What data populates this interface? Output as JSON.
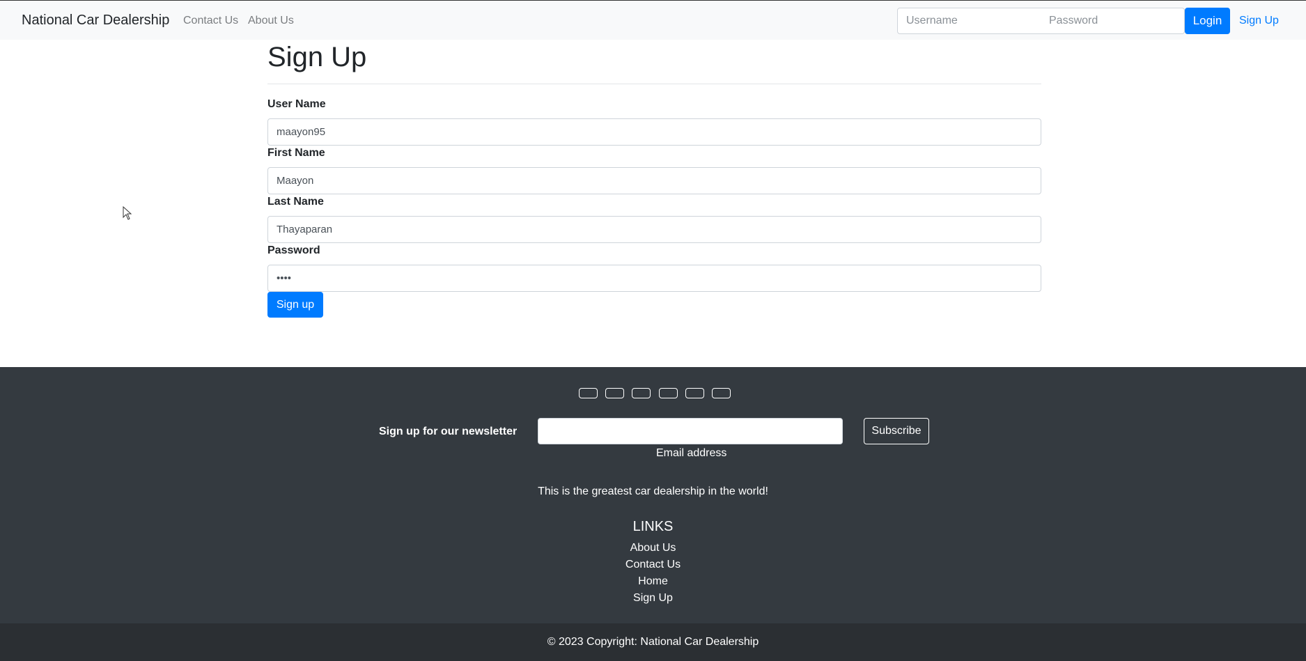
{
  "navbar": {
    "brand": "National Car Dealership",
    "links": [
      "Contact Us",
      "About Us"
    ],
    "username_placeholder": "Username",
    "password_placeholder": "Password",
    "login_label": "Login",
    "signup_label": "Sign Up"
  },
  "form": {
    "title": "Sign Up",
    "username_label": "User Name",
    "username_value": "maayon95",
    "firstname_label": "First Name",
    "firstname_value": "Maayon",
    "lastname_label": "Last Name",
    "lastname_value": "Thayaparan",
    "password_label": "Password",
    "password_value": "abcd",
    "submit_label": "Sign up"
  },
  "footer": {
    "social_icons": [
      "social-icon-1",
      "social-icon-2",
      "social-icon-3",
      "social-icon-4",
      "social-icon-5",
      "social-icon-6"
    ],
    "newsletter_label": "Sign up for our newsletter",
    "email_hint": "Email address",
    "subscribe_label": "Subscribe",
    "tagline": "This is the greatest car dealership in the world!",
    "links_title": "LINKS",
    "links": [
      "About Us",
      "Contact Us",
      "Home",
      "Sign Up"
    ],
    "copyright": "© 2023 Copyright: National Car Dealership"
  },
  "colors": {
    "primary": "#007bff",
    "footer_bg": "#343a40",
    "copyright_bg": "#2b2f33",
    "navbar_bg": "#f8f9fa"
  }
}
